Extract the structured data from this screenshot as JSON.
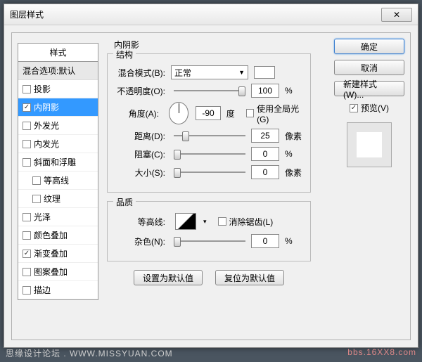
{
  "window": {
    "title": "图层样式",
    "close": "✕"
  },
  "styles": {
    "header": "样式",
    "blend_default": "混合选项:默认",
    "items": [
      {
        "label": "投影",
        "checked": false,
        "indent": false
      },
      {
        "label": "内阴影",
        "checked": true,
        "indent": false,
        "selected": true
      },
      {
        "label": "外发光",
        "checked": false,
        "indent": false
      },
      {
        "label": "内发光",
        "checked": false,
        "indent": false
      },
      {
        "label": "斜面和浮雕",
        "checked": false,
        "indent": false
      },
      {
        "label": "等高线",
        "checked": false,
        "indent": true
      },
      {
        "label": "纹理",
        "checked": false,
        "indent": true
      },
      {
        "label": "光泽",
        "checked": false,
        "indent": false
      },
      {
        "label": "颜色叠加",
        "checked": false,
        "indent": false
      },
      {
        "label": "渐变叠加",
        "checked": true,
        "indent": false
      },
      {
        "label": "图案叠加",
        "checked": false,
        "indent": false
      },
      {
        "label": "描边",
        "checked": false,
        "indent": false
      }
    ]
  },
  "main": {
    "title": "内阴影",
    "structure": {
      "legend": "结构",
      "blend_mode_label": "混合模式(B):",
      "blend_mode_value": "正常",
      "opacity_label": "不透明度(O):",
      "opacity_value": "100",
      "opacity_unit": "%",
      "angle_label": "角度(A):",
      "angle_value": "-90",
      "angle_unit": "度",
      "global_light": "使用全局光(G)",
      "distance_label": "距离(D):",
      "distance_value": "25",
      "distance_unit": "像素",
      "choke_label": "阻塞(C):",
      "choke_value": "0",
      "choke_unit": "%",
      "size_label": "大小(S):",
      "size_value": "0",
      "size_unit": "像素"
    },
    "quality": {
      "legend": "品质",
      "contour_label": "等高线:",
      "antialias": "消除锯齿(L)",
      "noise_label": "杂色(N):",
      "noise_value": "0",
      "noise_unit": "%"
    },
    "buttons": {
      "default": "设置为默认值",
      "reset": "复位为默认值"
    }
  },
  "right": {
    "ok": "确定",
    "cancel": "取消",
    "new_style": "新建样式(W)...",
    "preview_label": "预览(V)"
  },
  "footer": {
    "left": "思缘设计论坛 . WWW.MISSYUAN.COM",
    "right": "bbs.16XX8.com"
  }
}
